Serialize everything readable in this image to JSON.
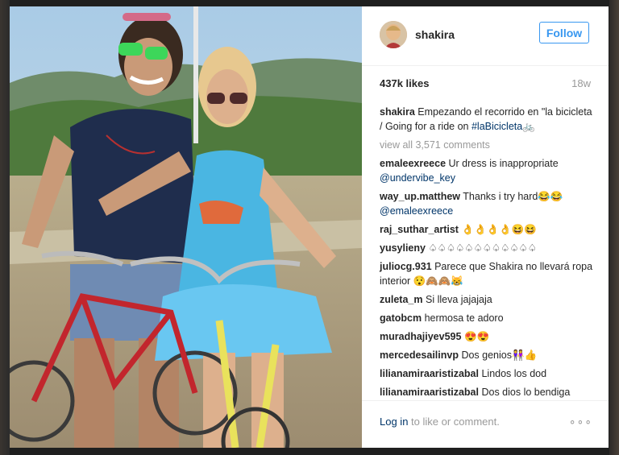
{
  "post": {
    "username": "shakira",
    "follow_label": "Follow",
    "likes": "437k likes",
    "age": "18w",
    "caption_user": "shakira",
    "caption_text": "Empezando el recorrido en \"la bicicleta / Going for a ride on",
    "caption_tag": "#laBicicleta",
    "caption_emoji": "🚲",
    "view_all": "view all 3,571 comments"
  },
  "comments": [
    {
      "user": "emaleexreece",
      "text": "Ur dress is inappropriate",
      "mention": "@undervibe_key"
    },
    {
      "user": "way_up.matthew",
      "text": "Thanks i try hard😂😂",
      "mention": "@emaleexreece"
    },
    {
      "user": "raj_suthar_artist",
      "text": "👌👌👌👌😆😆",
      "mention": ""
    },
    {
      "user": "yusylieny",
      "text": "♤♤♤♤♤♤♤♤♤♤♤♤",
      "mention": ""
    },
    {
      "user": "juliocg.931",
      "text": "Parece que Shakira no llevará ropa interior 😯🙈🙈😹",
      "mention": ""
    },
    {
      "user": "zuleta_m",
      "text": "Si lleva jajajaja",
      "mention": ""
    },
    {
      "user": "gatobcm",
      "text": "hermosa te adoro",
      "mention": ""
    },
    {
      "user": "muradhajiyev595",
      "text": "😍😍",
      "mention": ""
    },
    {
      "user": "mercedesailinvp",
      "text": "Dos genios👭👍",
      "mention": ""
    },
    {
      "user": "lilianamiraaristizabal",
      "text": "Lindos los dod",
      "mention": ""
    },
    {
      "user": "lilianamiraaristizabal",
      "text": "Dos dios lo bendiga",
      "mention": ""
    }
  ],
  "footer": {
    "login_link": "Log in",
    "login_rest": " to like or comment.",
    "more_glyph": "∘∘∘"
  },
  "icons": {
    "more": "more-options-icon"
  },
  "colors": {
    "accent": "#3897f0",
    "link": "#003569",
    "muted": "#999999"
  }
}
